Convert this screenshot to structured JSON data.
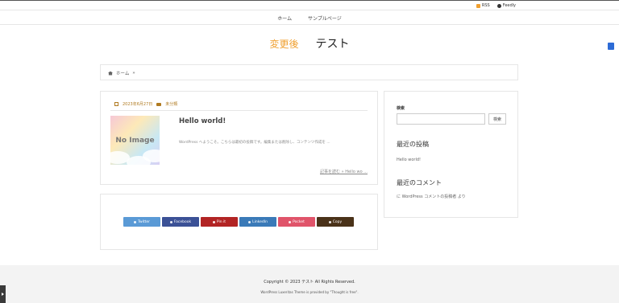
{
  "topbar": {
    "feeds": [
      {
        "label": "RSS",
        "icon": "rss-icon"
      },
      {
        "label": "Feedly",
        "icon": "feedly-icon"
      }
    ]
  },
  "nav": {
    "items": [
      "ホーム",
      "サンプルページ"
    ]
  },
  "site": {
    "subtitle": "変更後",
    "title": "テスト"
  },
  "breadcrumb": {
    "home": "ホーム",
    "sep": "»"
  },
  "post": {
    "date": "2023年6月27日",
    "category": "未分類",
    "thumbnail_text": "No Image",
    "title": "Hello world!",
    "excerpt": "WordPress へようこそ。こちらは最初の投稿です。編集または削除し、コンテンツ作成を ...",
    "read_more": "記事を読む » Hello wo ..."
  },
  "share": {
    "buttons": [
      {
        "label": "Twitter",
        "color": "#5a9ad6"
      },
      {
        "label": "Facebook",
        "color": "#3b5196"
      },
      {
        "label": "Pin it",
        "color": "#b22424"
      },
      {
        "label": "LinkedIn",
        "color": "#3a7ab8"
      },
      {
        "label": "Pocket",
        "color": "#e0546a"
      },
      {
        "label": "Copy",
        "color": "#4a3219"
      }
    ]
  },
  "sidebar": {
    "search_label": "検索",
    "search_placeholder": "",
    "search_button": "検索",
    "recent_posts_heading": "最近の投稿",
    "recent_posts": [
      "Hello world!"
    ],
    "recent_comments_heading": "最近のコメント",
    "recent_comment": "に WordPress コメントの投稿者 より"
  },
  "footer": {
    "copyright": "Copyright © 2023 テスト All Rights Reserved.",
    "credit": "WordPress Luxeritas Theme is provided by \"Thought is free\"."
  },
  "colors": {
    "accent": "#f0a030",
    "meta": "#b07a20",
    "footer_bg": "#f3f3f3"
  }
}
